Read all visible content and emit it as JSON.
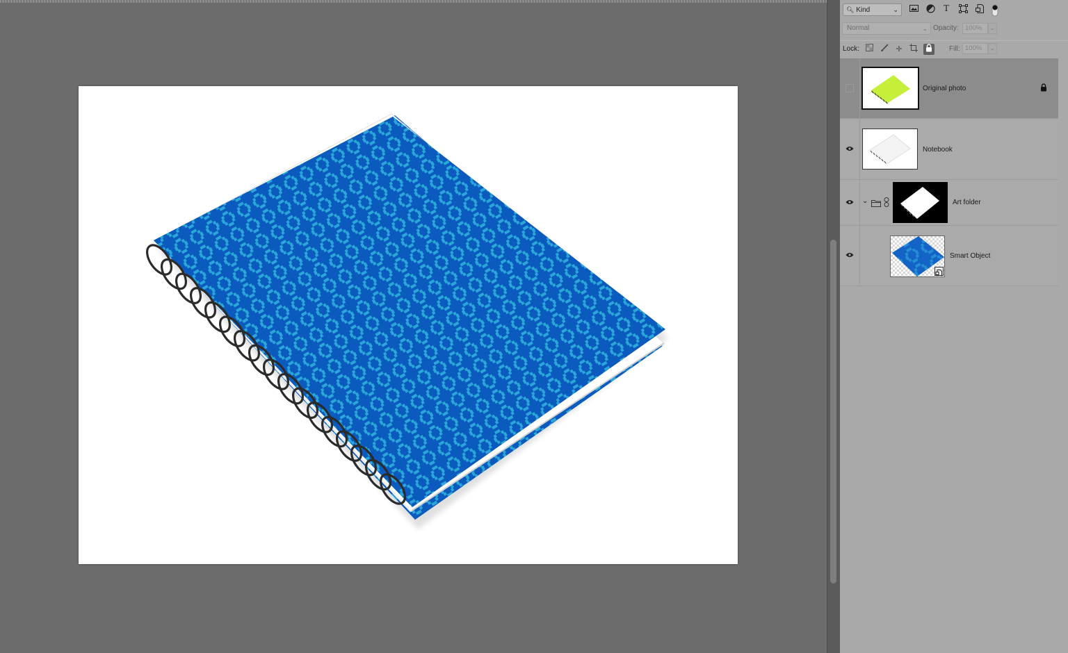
{
  "filter": {
    "kind_label": "Kind",
    "icons": [
      "image-filter-icon",
      "adjustment-filter-icon",
      "type-filter-icon",
      "shape-filter-icon",
      "smart-object-filter-icon",
      "filter-toggle-icon"
    ]
  },
  "blend": {
    "mode": "Normal",
    "opacity_label": "Opacity:",
    "opacity_value": "100%"
  },
  "lock": {
    "label": "Lock:",
    "icons": [
      "lock-transparent-icon",
      "lock-paint-icon",
      "lock-position-icon",
      "lock-artboard-icon",
      "lock-all-icon"
    ],
    "fill_label": "Fill:",
    "fill_value": "100%"
  },
  "layers": [
    {
      "name": "Original photo",
      "visible": false,
      "locked": true,
      "selected": true
    },
    {
      "name": "Notebook",
      "visible": true,
      "locked": false,
      "selected": false
    },
    {
      "name": "Art folder",
      "visible": true,
      "type": "group",
      "expanded": true
    },
    {
      "name": "Smart Object",
      "visible": true,
      "type": "smart-object"
    }
  ],
  "colors": {
    "cover_blue": "#0b5bbf",
    "pattern_cyan": "#2aa6d8",
    "photo_green": "#c6ef3a",
    "panel_bg": "#a9a9a9",
    "canvas_bg": "#6c6c6c"
  }
}
